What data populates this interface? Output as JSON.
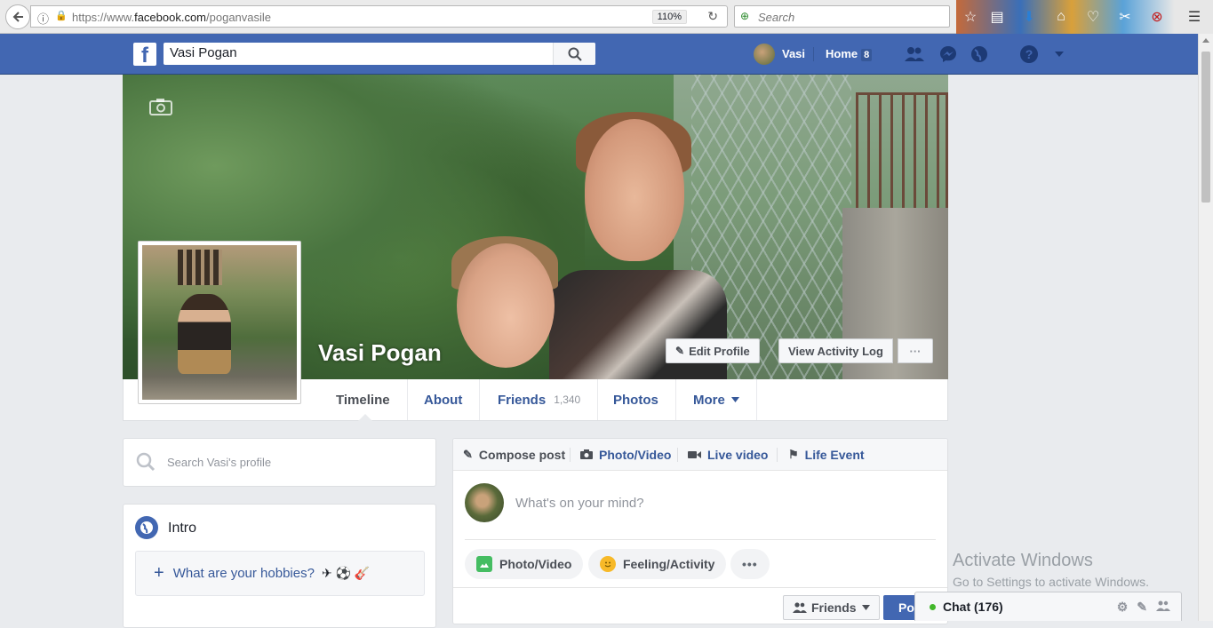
{
  "browser": {
    "url_prefix": "https://www.",
    "url_domain": "facebook.com",
    "url_path": "/poganvasile",
    "zoom": "110%",
    "search_placeholder": "Search",
    "icons": [
      "back-icon",
      "info-icon",
      "lock-icon",
      "reload-icon",
      "star-icon",
      "reading-list-icon",
      "download-icon",
      "home-icon",
      "pocket-icon",
      "tools-icon",
      "stop-icon",
      "menu-icon"
    ]
  },
  "fb_header": {
    "logo": "f",
    "search_value": "Vasi Pogan",
    "user_name": "Vasi",
    "home_label": "Home",
    "home_count": "8"
  },
  "profile": {
    "name": "Vasi Pogan",
    "edit_profile": "Edit Profile",
    "view_activity_log": "View Activity Log",
    "more_dots": "···"
  },
  "tabs": [
    {
      "label": "Timeline"
    },
    {
      "label": "About"
    },
    {
      "label": "Friends",
      "count": "1,340"
    },
    {
      "label": "Photos"
    },
    {
      "label": "More"
    }
  ],
  "left": {
    "search_placeholder": "Search Vasi's profile",
    "intro_title": "Intro",
    "hobbies_prompt": "What are your hobbies?",
    "hobby_emojis": "✈ ⚽ 🎸"
  },
  "composer": {
    "tabs": [
      {
        "label": "Compose post",
        "icon": "pencil-icon"
      },
      {
        "label": "Photo/Video",
        "icon": "camera-icon"
      },
      {
        "label": "Live video",
        "icon": "video-icon"
      },
      {
        "label": "Life Event",
        "icon": "flag-icon"
      }
    ],
    "placeholder": "What's on your mind?",
    "photo_video": "Photo/Video",
    "feeling": "Feeling/Activity",
    "more": "•••",
    "audience": "Friends",
    "post": "Post"
  },
  "overlay": {
    "activate_title": "Activate Windows",
    "activate_sub": "Go to Settings to activate Windows."
  },
  "chat": {
    "label": "Chat (176)"
  }
}
